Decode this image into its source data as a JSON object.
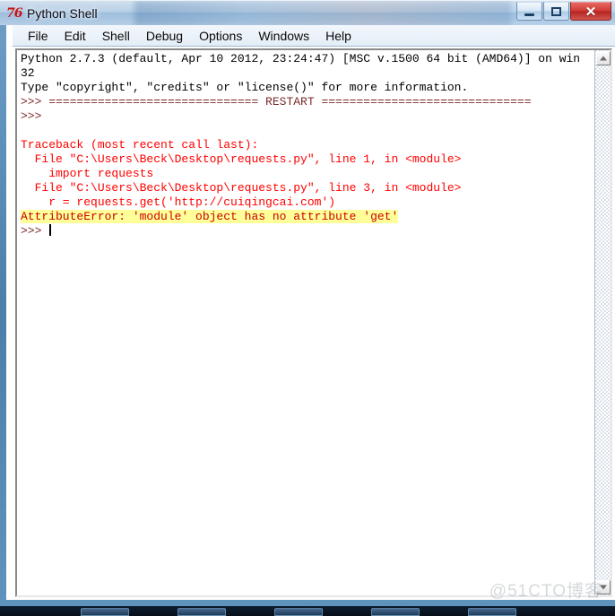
{
  "window": {
    "title": "Python Shell",
    "icon": "python-logo-icon",
    "icon_glyph": "76",
    "controls": {
      "minimize_label": "Minimize",
      "maximize_label": "Maximize",
      "close_label": "✕"
    }
  },
  "menubar": {
    "items": [
      {
        "label": "File"
      },
      {
        "label": "Edit"
      },
      {
        "label": "Shell"
      },
      {
        "label": "Debug"
      },
      {
        "label": "Options"
      },
      {
        "label": "Windows"
      },
      {
        "label": "Help"
      }
    ]
  },
  "shell": {
    "lines": [
      {
        "id": "banner-1",
        "kind": "stdout",
        "text": "Python 2.7.3 (default, Apr 10 2012, 23:24:47) [MSC v.1500 64 bit (AMD64)] on win"
      },
      {
        "id": "banner-2",
        "kind": "stdout",
        "text": "32"
      },
      {
        "id": "banner-3",
        "kind": "stdout",
        "text": "Type \"copyright\", \"credits\" or \"license()\" for more information."
      },
      {
        "id": "restart",
        "kind": "prompt",
        "text": ">>> ============================== RESTART =============================="
      },
      {
        "id": "prompt-blank",
        "kind": "prompt",
        "text": ">>> "
      },
      {
        "id": "spacer-1",
        "kind": "stdout",
        "text": ""
      },
      {
        "id": "tb-header",
        "kind": "error",
        "text": "Traceback (most recent call last):"
      },
      {
        "id": "tb-file-1",
        "kind": "error",
        "text": "  File \"C:\\Users\\Beck\\Desktop\\requests.py\", line 1, in <module>"
      },
      {
        "id": "tb-code-1",
        "kind": "error",
        "text": "    import requests"
      },
      {
        "id": "tb-file-2",
        "kind": "error",
        "text": "  File \"C:\\Users\\Beck\\Desktop\\requests.py\", line 3, in <module>"
      },
      {
        "id": "tb-code-2",
        "kind": "error",
        "text": "    r = requests.get('http://cuiqingcai.com')"
      },
      {
        "id": "tb-exception",
        "kind": "highlight",
        "text": "AttributeError: 'module' object has no attribute 'get'"
      },
      {
        "id": "prompt-final",
        "kind": "prompt-cursor",
        "text": ">>> "
      }
    ]
  },
  "scrollbar": {
    "up_arrow": "scroll-up-arrow-icon",
    "down_arrow": "scroll-down-arrow-icon"
  },
  "watermark": {
    "text": "@51CTO博客"
  },
  "colors": {
    "stdout": "#000000",
    "prompt": "#7d2a2a",
    "error": "#ff0000",
    "highlight_background": "#ffff99",
    "highlight_text": "#cc0000",
    "close_button": "#cf3a35",
    "window_frame": "#5d8fba"
  }
}
